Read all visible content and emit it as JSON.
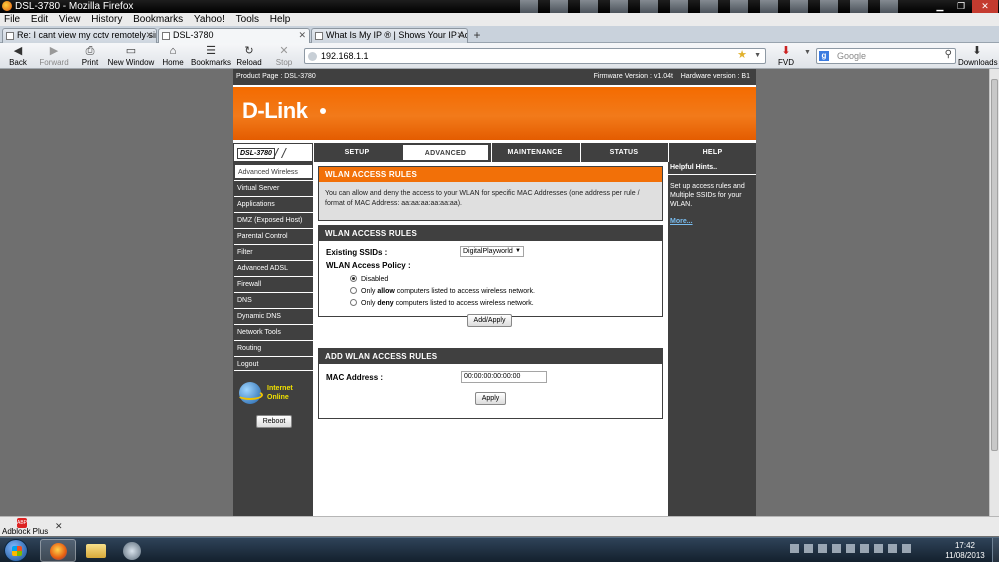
{
  "window": {
    "title": "DSL-3780 - Mozilla Firefox"
  },
  "menubar": [
    "File",
    "Edit",
    "View",
    "History",
    "Bookmarks",
    "Yahoo!",
    "Tools",
    "Help"
  ],
  "tabs": [
    {
      "label": "Re: I cant view my cctv remotely sinc..."
    },
    {
      "label": "DSL-3780"
    },
    {
      "label": "What Is My IP ® | Shows Your IP Add..."
    }
  ],
  "toolbar": {
    "back": "Back",
    "forward": "Forward",
    "print": "Print",
    "new_window": "New Window",
    "home": "Home",
    "bookmarks": "Bookmarks",
    "reload": "Reload",
    "stop": "Stop",
    "fvd": "FVD",
    "downloads": "Downloads"
  },
  "address": {
    "url": "192.168.1.1"
  },
  "search": {
    "placeholder": "Google"
  },
  "router": {
    "product": "Product Page : DSL-3780",
    "firmware": "Firmware Version : v1.04t",
    "hardware": "Hardware version : B1",
    "brand": "D-Link",
    "model": "DSL-3780",
    "main_tabs": [
      "SETUP",
      "ADVANCED",
      "MAINTENANCE",
      "STATUS",
      "HELP"
    ],
    "side_nav": [
      "Advanced Wireless",
      "Virtual Server",
      "Applications",
      "DMZ (Exposed Host)",
      "Parental Control",
      "Filter",
      "Advanced ADSL",
      "Firewall",
      "DNS",
      "Dynamic DNS",
      "Network Tools",
      "Routing",
      "Logout"
    ],
    "internet_line1": "Internet",
    "internet_line2": "Online",
    "reboot": "Reboot",
    "section1": {
      "title": "WLAN ACCESS RULES",
      "desc": "You can allow and deny the access to your WLAN for specific MAC Addresses (one address per rule / format of MAC Address: aa:aa:aa:aa:aa:aa)."
    },
    "section2": {
      "title": "WLAN ACCESS RULES",
      "ssid_label": "Existing SSIDs :",
      "ssid_value": "DigitalPlayworld",
      "policy_label": "WLAN Access Policy :",
      "opt_disabled": "Disabled",
      "opt_allow_pre": "Only ",
      "opt_allow_bold": "allow",
      "opt_allow_post": " computers listed to access wireless network.",
      "opt_deny_pre": "Only ",
      "opt_deny_bold": "deny",
      "opt_deny_post": " computers listed to access wireless network.",
      "apply": "Add/Apply"
    },
    "section3": {
      "title": "ADD WLAN ACCESS RULES",
      "mac_label": "MAC Address :",
      "mac_value": "00:00:00:00:00:00",
      "apply": "Apply"
    },
    "hints": {
      "title": "Helpful Hints..",
      "text": "Set up access rules and Multiple SSIDs for your WLAN.",
      "more": "More..."
    }
  },
  "addon": {
    "label": "Adblock Plus",
    "badge": "ABP"
  },
  "clock": {
    "time": "17:42",
    "date": "11/08/2013"
  }
}
